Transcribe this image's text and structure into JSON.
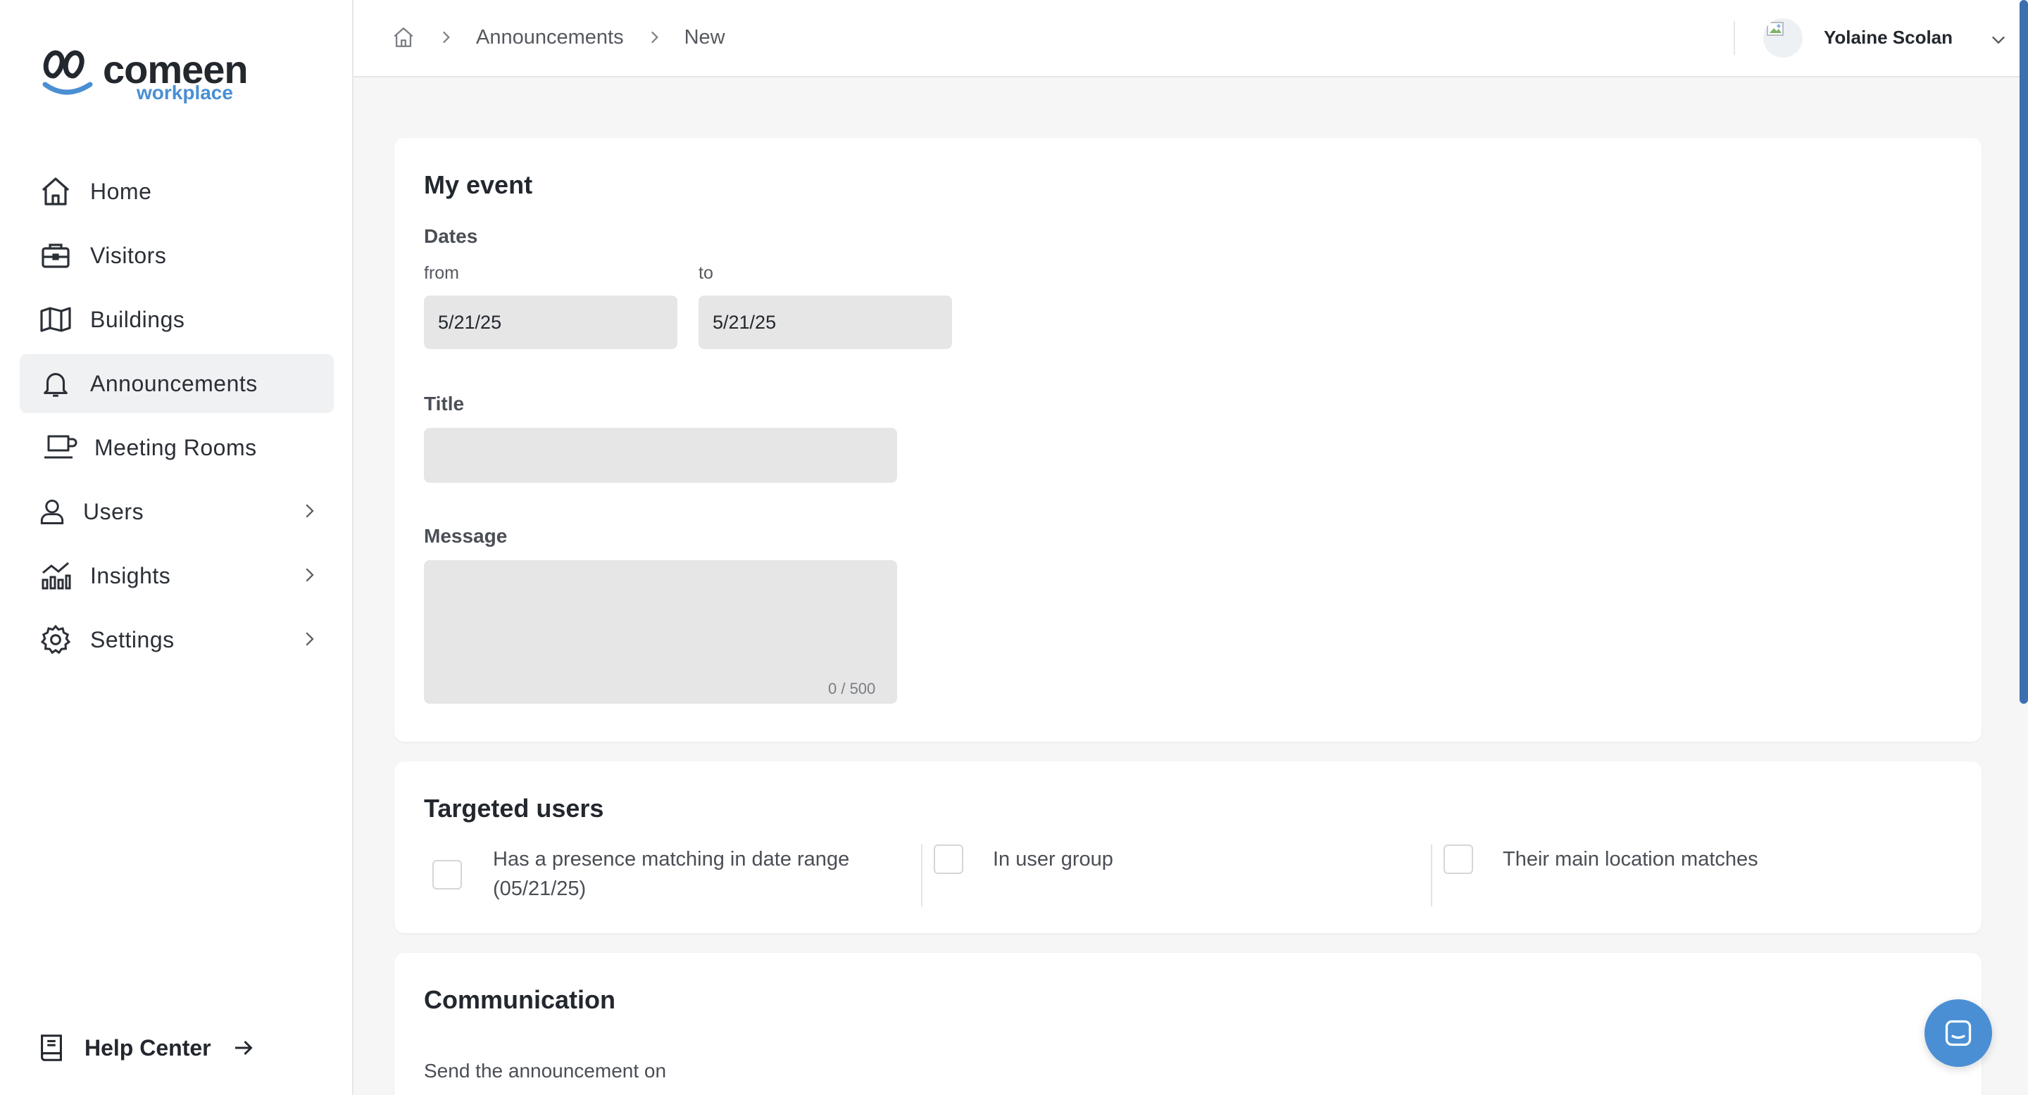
{
  "app": {
    "logo_text": "comeen",
    "logo_sub": "workplace"
  },
  "sidebar": {
    "items": [
      {
        "label": "Home",
        "icon": "home-icon"
      },
      {
        "label": "Visitors",
        "icon": "briefcase-icon"
      },
      {
        "label": "Buildings",
        "icon": "map-icon"
      },
      {
        "label": "Announcements",
        "icon": "bell-icon",
        "active": true
      },
      {
        "label": "Meeting Rooms",
        "icon": "monitor-cup-icon"
      },
      {
        "label": "Users",
        "icon": "user-icon",
        "has_chevron": true
      },
      {
        "label": "Insights",
        "icon": "chart-icon",
        "has_chevron": true
      },
      {
        "label": "Settings",
        "icon": "gear-icon",
        "has_chevron": true
      }
    ],
    "help_label": "Help Center"
  },
  "header": {
    "breadcrumbs": [
      "Announcements",
      "New"
    ],
    "user_name": "Yolaine Scolan"
  },
  "event": {
    "heading": "My event",
    "dates_label": "Dates",
    "from_label": "from",
    "to_label": "to",
    "from_value": "5/21/25",
    "to_value": "5/21/25",
    "title_label": "Title",
    "title_value": "",
    "message_label": "Message",
    "message_value": "",
    "message_counter": "0 / 500"
  },
  "targeted": {
    "heading": "Targeted users",
    "options": [
      {
        "label_line1": "Has a presence matching in date range",
        "label_line2": "(05/21/25)",
        "checked": false
      },
      {
        "label_line1": "In user group",
        "checked": false
      },
      {
        "label_line1": "Their main location matches",
        "checked": false
      }
    ]
  },
  "communication": {
    "heading": "Communication",
    "send_label": "Send the announcement on"
  },
  "colors": {
    "accent": "#4a8fd4",
    "active_bg": "#f0f1f2",
    "input_bg": "#e6e6e6"
  }
}
